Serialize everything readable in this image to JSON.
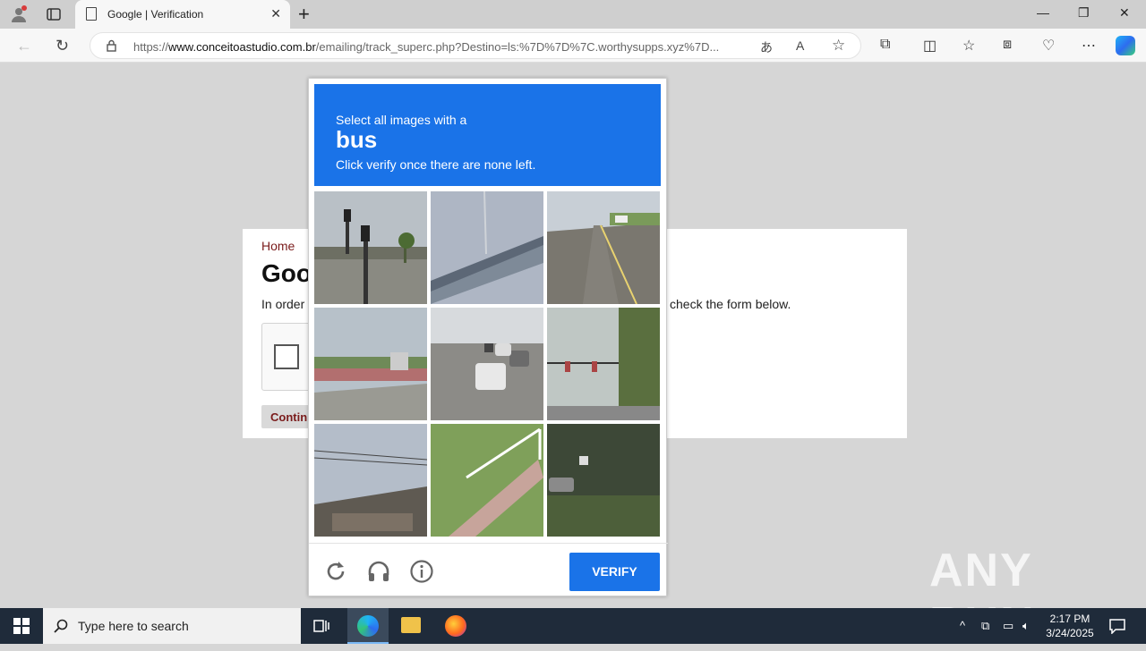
{
  "browser": {
    "tab_title": "Google | Verification",
    "url_prefix": "https://",
    "url_host": "www.conceitoastudio.com.br",
    "url_rest": "/emailing/track_superc.php?Destino=ls:%7D%7D%7C.worthysupps.xyz%7D..."
  },
  "page": {
    "breadcrumb": "Home",
    "heading": "Goo",
    "intro_left": "In order",
    "intro_right": "check the form below.",
    "continue_label": "Contin"
  },
  "captcha": {
    "line1": "Select all images with a",
    "target": "bus",
    "line3": "Click verify once there are none left.",
    "verify_label": "VERIFY",
    "accent": "#1a73e8"
  },
  "watermark": "ANY RUN",
  "taskbar": {
    "search_placeholder": "Type here to search",
    "time": "2:17 PM",
    "date": "3/24/2025"
  }
}
